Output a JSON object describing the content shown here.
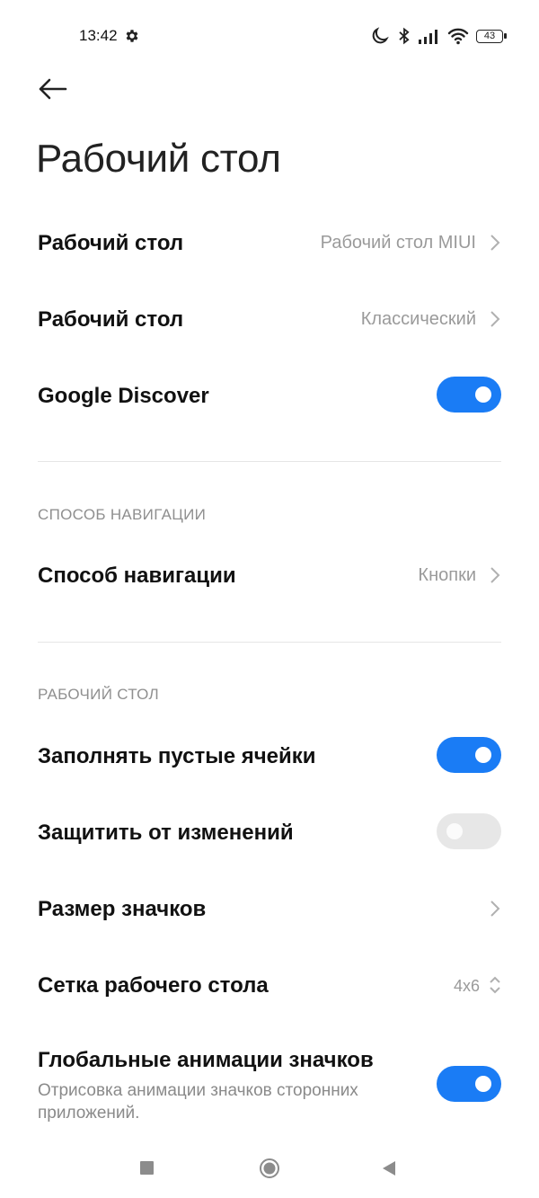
{
  "status_bar": {
    "time": "13:42",
    "battery": "43",
    "icons": [
      "gear-icon",
      "moon-icon",
      "bluetooth-icon",
      "signal-icon",
      "wifi-icon",
      "battery-icon"
    ]
  },
  "header": {
    "back_icon": "arrow-left-icon",
    "title": "Рабочий стол"
  },
  "colors": {
    "accent": "#1a7cf5",
    "toggle_off": "#e7e7e7",
    "secondary_text": "#9a9a9a"
  },
  "items": {
    "desktop_type": {
      "label": "Рабочий стол",
      "value": "Рабочий стол MIUI"
    },
    "desktop_layout": {
      "label": "Рабочий стол",
      "value": "Классический"
    },
    "google_discover": {
      "label": "Google Discover",
      "enabled": true
    }
  },
  "navigation": {
    "section_title": "СПОСОБ НАВИГАЦИИ",
    "method": {
      "label": "Способ навигации",
      "value": "Кнопки"
    }
  },
  "desktop_section": {
    "section_title": "РАБОЧИЙ СТОЛ",
    "fill_empty": {
      "label": "Заполнять пустые ячейки",
      "enabled": true
    },
    "lock_layout": {
      "label": "Защитить от изменений",
      "enabled": false
    },
    "icon_size": {
      "label": "Размер значков"
    },
    "grid": {
      "label": "Сетка рабочего стола",
      "value": "4x6"
    },
    "global_anim": {
      "label": "Глобальные анимации значков",
      "description": "Отрисовка анимации значков сторонних приложений.",
      "enabled": true
    }
  },
  "nav_bar": {
    "buttons": [
      "recents-square-icon",
      "home-circle-icon",
      "back-triangle-icon"
    ]
  }
}
